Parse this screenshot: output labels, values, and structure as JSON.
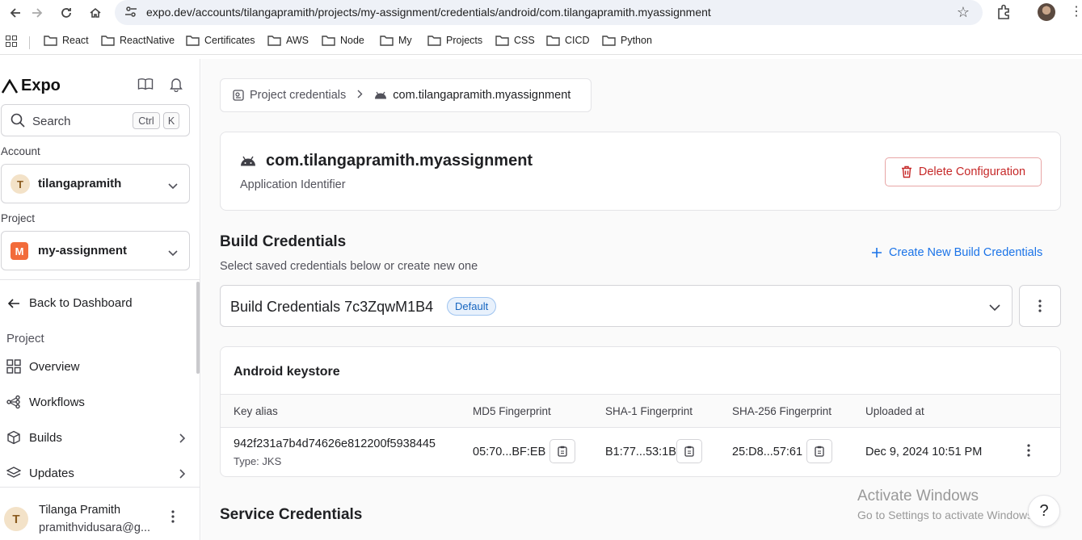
{
  "browser": {
    "url": "expo.dev/accounts/tilangapramith/projects/my-assignment/credentials/android/com.tilangapramith.myassignment",
    "bookmarks": [
      "React",
      "ReactNative",
      "Certificates",
      "AWS",
      "Node",
      "My",
      "Projects",
      "CSS",
      "CICD",
      "Python"
    ]
  },
  "sidebar": {
    "logo": "Expo",
    "search": {
      "placeholder": "Search",
      "kbd1": "Ctrl",
      "kbd2": "K"
    },
    "account": {
      "label": "Account",
      "initial": "T",
      "value": "tilangapramith"
    },
    "project": {
      "label": "Project",
      "initial": "M",
      "value": "my-assignment"
    },
    "back": "Back to Dashboard",
    "section": "Project",
    "items": [
      {
        "label": "Overview",
        "icon": "grid-icon"
      },
      {
        "label": "Workflows",
        "icon": "workflow-icon"
      },
      {
        "label": "Builds",
        "icon": "box-icon"
      },
      {
        "label": "Updates",
        "icon": "layers-icon"
      }
    ],
    "user": {
      "initial": "T",
      "name": "Tilanga Pramith",
      "email": "pramithvidusara@g..."
    }
  },
  "main": {
    "breadcrumb": {
      "parent": "Project credentials",
      "current": "com.tilangapramith.myassignment"
    },
    "app": {
      "identifier": "com.tilangapramith.myassignment",
      "subtitle": "Application Identifier",
      "delete_label": "Delete Configuration"
    },
    "build": {
      "heading": "Build Credentials",
      "description": "Select saved credentials below or create new one",
      "create_label": "Create New Build Credentials",
      "selected": "Build Credentials 7c3ZqwM1B4",
      "badge": "Default"
    },
    "keystore": {
      "title": "Android keystore",
      "columns": [
        "Key alias",
        "MD5 Fingerprint",
        "SHA-1 Fingerprint",
        "SHA-256 Fingerprint",
        "Uploaded at"
      ],
      "row": {
        "alias": "942f231a7b4d74626e812200f5938445",
        "type": "Type: JKS",
        "md5": "05:70...BF:EB",
        "sha1": "B1:77...53:1B",
        "sha256": "25:D8...57:61",
        "uploaded": "Dec 9, 2024 10:51 PM"
      }
    },
    "service_heading": "Service Credentials"
  },
  "watermark": {
    "title": "Activate Windows",
    "subtitle": "Go to Settings to activate Windows."
  },
  "help": "?",
  "colors": {
    "accent": "#1a73e8",
    "danger": "#c62828",
    "project_badge": "#f26b3a",
    "account_badge": "#f3e2c8"
  }
}
